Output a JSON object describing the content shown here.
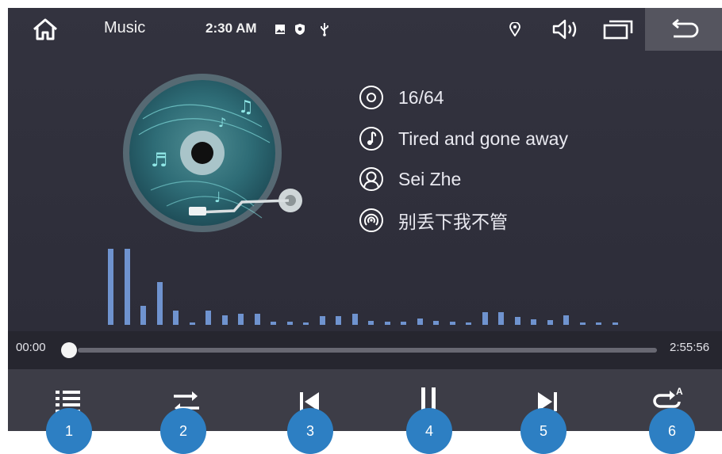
{
  "status_bar": {
    "title": "Music",
    "time": "2:30 AM",
    "icons": [
      "home-icon",
      "image-icon",
      "shield-icon",
      "usb-icon",
      "location-icon",
      "volume-icon",
      "recent-apps-icon",
      "back-icon"
    ]
  },
  "track_info": {
    "track_number": "16/64",
    "song_title": "Tired and gone away",
    "artist": "Sei Zhe",
    "album": "别丢下我不管"
  },
  "progress": {
    "elapsed": "00:00",
    "total": "2:55:56",
    "fraction": 0
  },
  "equalizer_levels": [
    96,
    96,
    24,
    54,
    18,
    3,
    18,
    12,
    14,
    14,
    4,
    4,
    3,
    11,
    11,
    14,
    5,
    4,
    4,
    8,
    5,
    4,
    3,
    16,
    16,
    10,
    7,
    6,
    12,
    3,
    3,
    3
  ],
  "controls": [
    {
      "icon": "playlist-icon",
      "callout": "1"
    },
    {
      "icon": "shuffle-icon",
      "callout": "2"
    },
    {
      "icon": "previous-icon",
      "callout": "3"
    },
    {
      "icon": "pause-icon",
      "callout": "4"
    },
    {
      "icon": "next-icon",
      "callout": "5"
    },
    {
      "icon": "repeat-a-icon",
      "callout": "6"
    }
  ],
  "colors": {
    "background": "#2e2e3a",
    "equalizer": "#6f93cf",
    "callout": "#2d7fc3",
    "disc": "#2c6f78"
  }
}
